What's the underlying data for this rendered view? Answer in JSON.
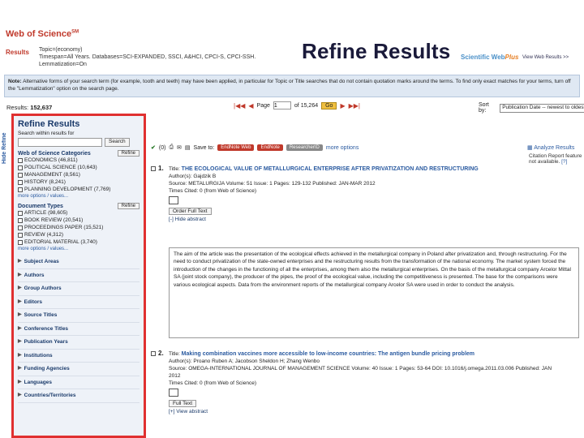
{
  "slide_title": "Refine Results",
  "header": {
    "logo_text": "Web of Science",
    "logo_sup": "SM",
    "results_label": "Results",
    "topic_line": "Topic=(economy)",
    "timespan_line": "Timespan=All Years. Databases=SCI-EXPANDED, SSCI, A&HCI, CPCI-S, CPCI-SSH.",
    "lemmatization_line": "Lemmatization=On",
    "sci_logo_prefix": "Scientific Web",
    "sci_logo_suffix": "Plus",
    "view_web": "View Web Results >>"
  },
  "note": {
    "label": "Note:",
    "text": "Alternative forms of your search term (for example, tooth and teeth) may have been applied, in particular for Topic or Title searches that do not contain quotation marks around the terms. To find only exact matches for your terms, turn off the \"Lemmatization\" option on the search page."
  },
  "results": {
    "label": "Results:",
    "count": "152,637"
  },
  "pager": {
    "page_label": "Page",
    "page_value": "1",
    "of_label": "of 15,264",
    "go_label": "Go",
    "first": "|◀◀",
    "prev": "◀",
    "next": "▶",
    "last": "▶▶|"
  },
  "sort": {
    "label": "Sort by:",
    "value": "Publication Date -- newest to oldest"
  },
  "hide_refine": "Hide Refine",
  "refine": {
    "title": "Refine Results",
    "search_within": "Search within results for",
    "search_button": "Search",
    "wos_categories": {
      "heading": "Web of Science Categories",
      "refine_button": "Refine",
      "items": [
        "ECONOMICS (46,811)",
        "POLITICAL SCIENCE (10,643)",
        "MANAGEMENT (8,561)",
        "HISTORY (8,241)",
        "PLANNING DEVELOPMENT (7,769)"
      ],
      "more": "more options / values..."
    },
    "doc_types": {
      "heading": "Document Types",
      "refine_button": "Refine",
      "items": [
        "ARTICLE (98,605)",
        "BOOK REVIEW (20,541)",
        "PROCEEDINGS PAPER (15,521)",
        "REVIEW (4,312)",
        "EDITORIAL MATERIAL (3,740)"
      ],
      "more": "more options / values..."
    },
    "collapsed": [
      "Subject Areas",
      "Authors",
      "Group Authors",
      "Editors",
      "Source Titles",
      "Conference Titles",
      "Publication Years",
      "Institutions",
      "Funding Agencies",
      "Languages",
      "Countries/Territories"
    ]
  },
  "toolbar": {
    "count": "(0)",
    "save_to": "Save to:",
    "btn_endnote_web": "EndNote Web",
    "btn_endnote": "EndNote",
    "btn_researcherid": "ResearcherID",
    "more_options": "more options",
    "analyze": "Analyze Results",
    "citation": "Citation Report feature not available.",
    "help": "[?]"
  },
  "records": [
    {
      "num": "1.",
      "title_label": "Title:",
      "title": "THE ECOLOGICAL VALUE OF METALLURGICAL ENTERPRISE AFTER PRIVATIZATION AND RESTRUCTURING",
      "authors": "Author(s): Gajdzik B",
      "source": "Source: METALURGIJA  Volume: 51   Issue: 1   Pages: 129-132   Published: JAN-MAR 2012",
      "cited": "Times Cited: 0 (from Web of Science)",
      "button": "Order Full Text",
      "abstract_toggle": "[-] Hide abstract",
      "abstract": "The aim of the article was the presentation of the ecological effects achieved in the metallurgical company in Poland after privatization and, through restructuring. For the need to conduct privatization of the state-owned enterprises and the restructuring results from the transformation of the national economy. The market system forced the introduction of the changes in the functioning of all the enterprises, among them also the metallurgical enterprises. On the basis of the metallurgical company Arcelor Mittal SA (joint stock company), the producer of the pipes, the proof of the ecological value, including the competitiveness is presented. The base for the comparisons were various ecological aspects. Data from the environment reports of the metallurgical company Arcelor SA were used in order to conduct the analysis."
    },
    {
      "num": "2.",
      "title_label": "Title:",
      "title": "Making combination vaccines more accessible to low-income countries: The antigen bundle pricing problem",
      "authors": "Author(s): Proano Ruben A; Jacobson Sheldon H; Zhang Wenbo",
      "source": "Source: OMEGA-INTERNATIONAL JOURNAL OF MANAGEMENT SCIENCE  Volume: 40   Issue: 1   Pages: 53-64   DOI: 10.1016/j.omega.2011.03.006   Published: JAN",
      "source2": "2012",
      "cited": "Times Cited: 0 (from Web of Science)",
      "button": "Full Text",
      "abstract_toggle": "[+] View abstract"
    }
  ],
  "colors": {
    "panel_border": "#e03030",
    "accent": "#c0392b",
    "link": "#2a5aa0"
  }
}
